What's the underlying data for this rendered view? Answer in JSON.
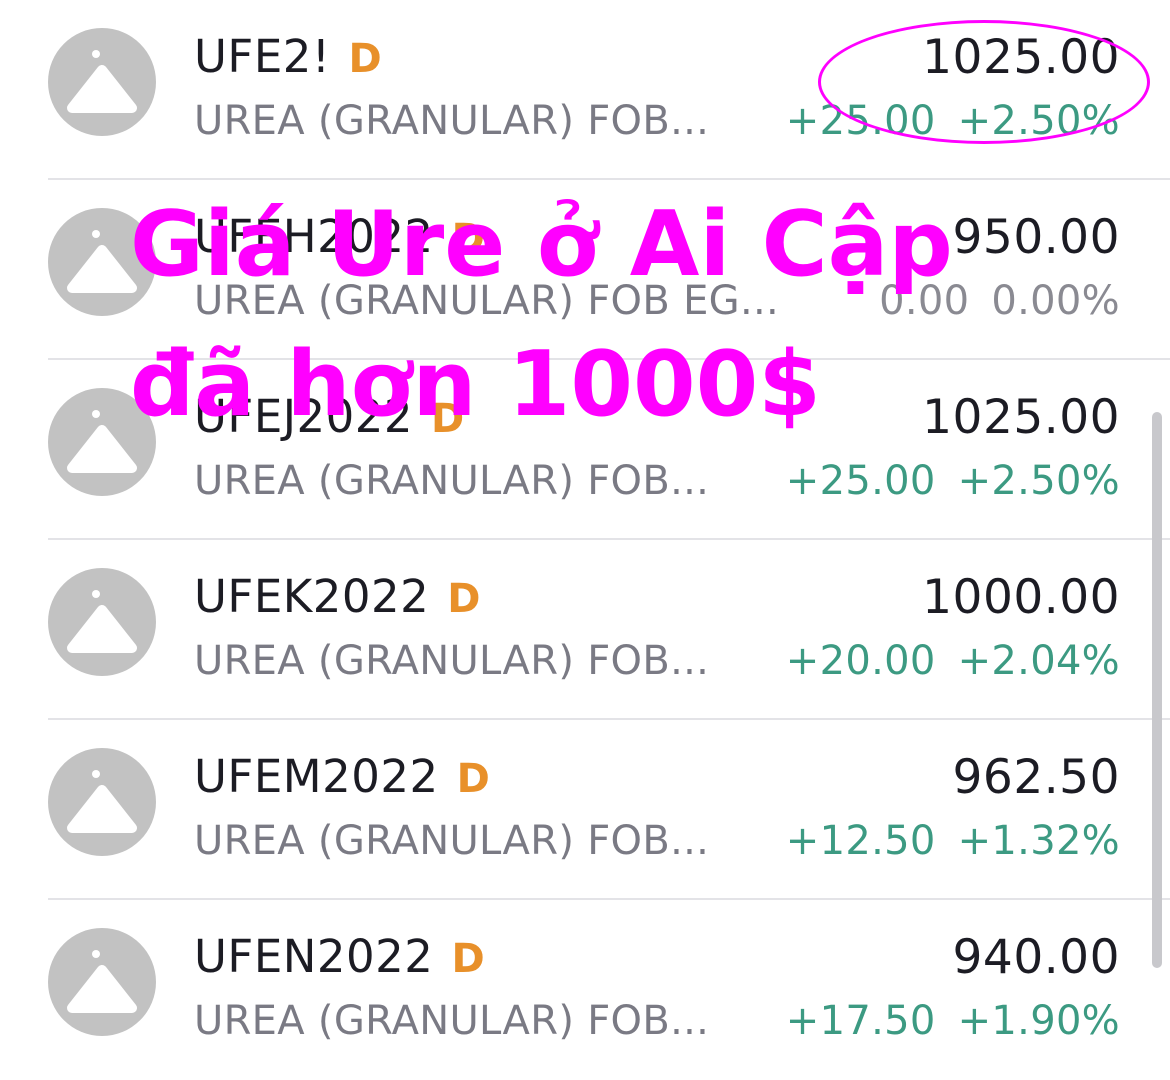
{
  "quotes": [
    {
      "symbol": "UFE2!",
      "badge": "D",
      "description": "UREA (GRANULAR) FOB...",
      "price": "1025.00",
      "change": "+25.00",
      "change_pct": "+2.50%",
      "direction": "up"
    },
    {
      "symbol": "UFEH2022",
      "badge": "D",
      "description": "UREA (GRANULAR) FOB EG...",
      "price": "950.00",
      "change": "0.00",
      "change_pct": "0.00%",
      "direction": "flat"
    },
    {
      "symbol": "UFEJ2022",
      "badge": "D",
      "description": "UREA (GRANULAR) FOB...",
      "price": "1025.00",
      "change": "+25.00",
      "change_pct": "+2.50%",
      "direction": "up"
    },
    {
      "symbol": "UFEK2022",
      "badge": "D",
      "description": "UREA (GRANULAR) FOB...",
      "price": "1000.00",
      "change": "+20.00",
      "change_pct": "+2.04%",
      "direction": "up"
    },
    {
      "symbol": "UFEM2022",
      "badge": "D",
      "description": "UREA (GRANULAR) FOB...",
      "price": "962.50",
      "change": "+12.50",
      "change_pct": "+1.32%",
      "direction": "up"
    },
    {
      "symbol": "UFEN2022",
      "badge": "D",
      "description": "UREA (GRANULAR) FOB...",
      "price": "940.00",
      "change": "+17.50",
      "change_pct": "+1.90%",
      "direction": "up"
    }
  ],
  "overlay": {
    "line1": "Giá Ure ở Ai Cập",
    "line2": "đã hơn 1000$"
  },
  "colors": {
    "positive": "#3c9a82",
    "neutral": "#8a8a92",
    "badge": "#e8902a",
    "annotation": "#ff00ff"
  },
  "icons": {
    "avatar": "triangle-placeholder-icon"
  }
}
